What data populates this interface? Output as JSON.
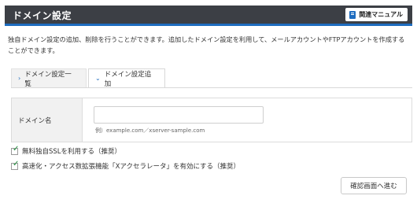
{
  "header": {
    "title": "ドメイン設定",
    "manual_label": "関連マニュアル"
  },
  "description": "独自ドメイン設定の追加、削除を行うことができます。追加したドメイン設定を利用して、メールアカウントやFTPアカウントを作成することができます。",
  "tabs": [
    {
      "label": "ドメイン設定一覧",
      "icon": "chevron-right-icon",
      "active": false
    },
    {
      "label": "ドメイン設定追加",
      "icon": "chevron-down-icon",
      "active": true
    }
  ],
  "form": {
    "domain_label": "ドメイン名",
    "domain_value": "",
    "domain_placeholder": "",
    "example": "例）example.com／xserver-sample.com"
  },
  "options": [
    {
      "label": "無料独自SSLを利用する（推奨）",
      "checked": true
    },
    {
      "label": "高速化・アクセス数拡張機能「Xアクセラレータ」を有効にする（推奨）",
      "checked": true
    }
  ],
  "confirm_button": "確認画面へ進む",
  "colors": {
    "header_bg": "#3c3f45",
    "accent": "#1e6cbf",
    "check": "#1e8c3a"
  }
}
